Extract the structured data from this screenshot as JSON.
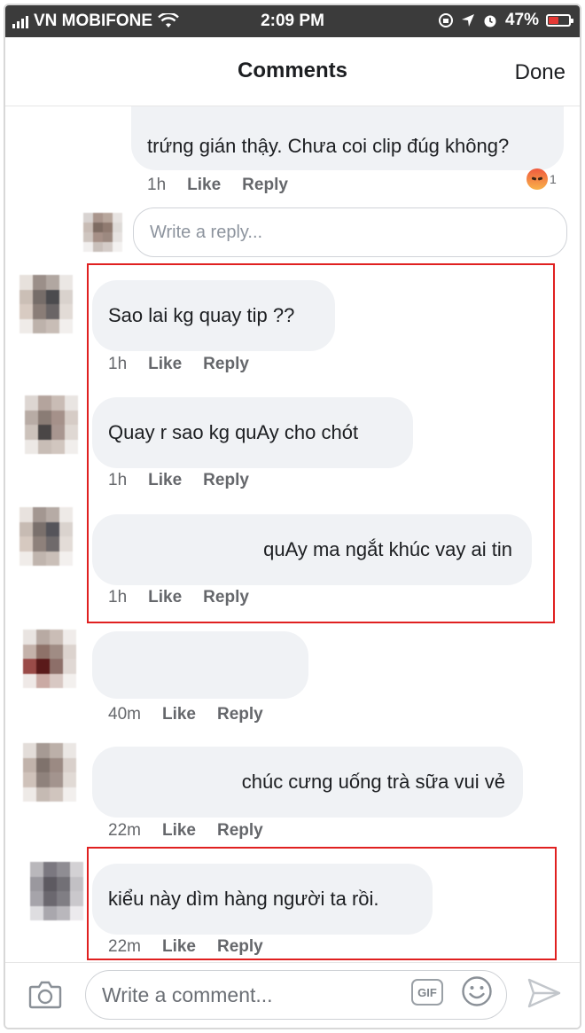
{
  "status_bar": {
    "carrier": "VN MOBIFONE",
    "time": "2:09 PM",
    "battery": "47%",
    "battery_level": 0.47
  },
  "header": {
    "title": "Comments",
    "done_label": "Done"
  },
  "top_reply": {
    "text": "trứng gián thậy. Chưa coi clip đúg không?",
    "time": "1h",
    "like": "Like",
    "reply": "Reply",
    "reaction_icon": "angry-reaction-icon",
    "reaction_count": "1"
  },
  "reply_input": {
    "placeholder": "Write a reply..."
  },
  "comments": [
    {
      "text": "Sao lai kg quay tip ??",
      "time": "1h",
      "like": "Like",
      "reply": "Reply"
    },
    {
      "text": "Quay r sao kg quAy cho chót",
      "time": "1h",
      "like": "Like",
      "reply": "Reply"
    },
    {
      "text": "quAy ma ngắt khúc vay ai tin",
      "time": "1h",
      "like": "Like",
      "reply": "Reply"
    },
    {
      "text": "",
      "time": "40m",
      "like": "Like",
      "reply": "Reply"
    },
    {
      "text": "chúc cưng uống trà sữa vui vẻ",
      "time": "22m",
      "like": "Like",
      "reply": "Reply"
    },
    {
      "text": "kiểu này dìm hàng người ta rồi.",
      "time": "22m",
      "like": "Like",
      "reply": "Reply"
    }
  ],
  "composer": {
    "placeholder": "Write a comment...",
    "gif_label": "GIF"
  },
  "colors": {
    "highlight": "#e02020",
    "bubble": "#f0f2f5",
    "status_bar": "#3b3b3b"
  }
}
